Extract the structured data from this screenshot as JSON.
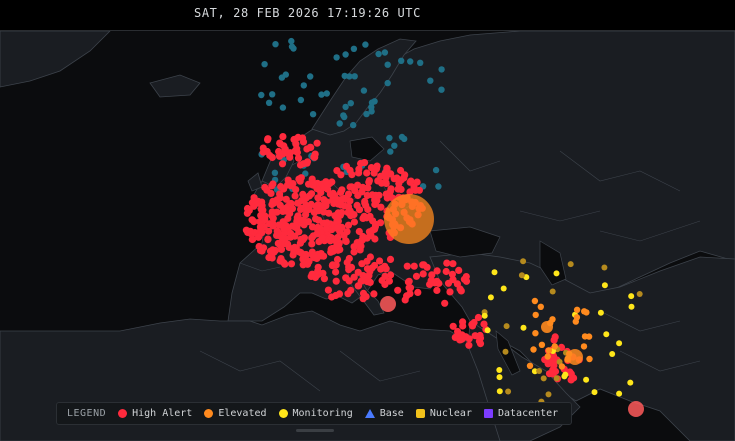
{
  "clock": "SAT, 28 FEB 2026 17:19:26 UTC",
  "legend": {
    "title": "LEGEND",
    "items": [
      {
        "label": "High Alert",
        "color": "#ff2a3d",
        "shape": "circle"
      },
      {
        "label": "Elevated",
        "color": "#ff8a1e",
        "shape": "circle"
      },
      {
        "label": "Monitoring",
        "color": "#ffe61a",
        "shape": "circle"
      },
      {
        "label": "Base",
        "color": "#4a7bff",
        "shape": "triangle"
      },
      {
        "label": "Nuclear",
        "color": "#f2c21b",
        "shape": "hexagon"
      },
      {
        "label": "Datacenter",
        "color": "#7c3cff",
        "shape": "square"
      }
    ]
  },
  "colors": {
    "background": "#0b0c0e",
    "land": "#1a1d22",
    "border": "#3d434b",
    "high_alert": "#ff2a3d",
    "elevated": "#ff8a1e",
    "monitoring": "#ffe61a",
    "infrastructure": "#1f6f86"
  }
}
